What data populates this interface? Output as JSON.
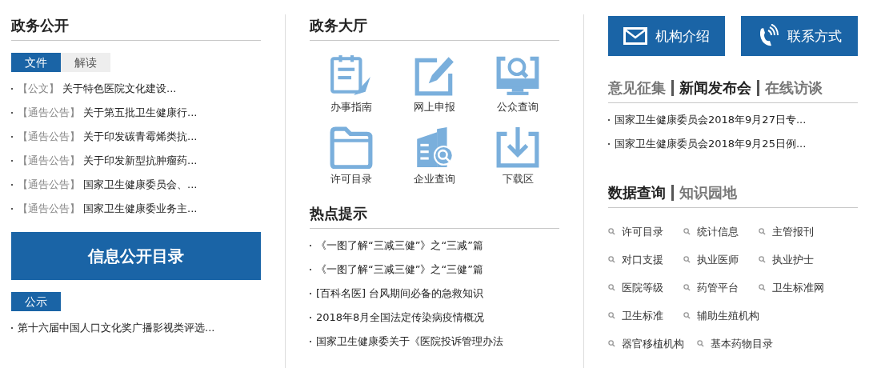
{
  "gov_open": {
    "title": "政务公开",
    "tabs": [
      {
        "label": "文件",
        "selected": true
      },
      {
        "label": "解读",
        "selected": false
      }
    ],
    "items": [
      {
        "tag": "【公文】",
        "text": "关于特色医院文化建设..."
      },
      {
        "tag": "【通告公告】",
        "text": "关于第五批卫生健康行..."
      },
      {
        "tag": "【通告公告】",
        "text": "关于印发碳青霉烯类抗..."
      },
      {
        "tag": "【通告公告】",
        "text": "关于印发新型抗肿瘤药..."
      },
      {
        "tag": "【通告公告】",
        "text": "国家卫生健康委员会、..."
      },
      {
        "tag": "【通告公告】",
        "text": "国家卫生健康委业务主..."
      }
    ],
    "catalog_button": "信息公开目录",
    "notice_tab": "公示",
    "notice_items": [
      "第十六届中国人口文化奖广播影视类评选..."
    ]
  },
  "hall": {
    "title": "政务大厅",
    "services": [
      {
        "kind": "guide",
        "label": "办事指南"
      },
      {
        "kind": "edit",
        "label": "网上申报"
      },
      {
        "kind": "monitor",
        "label": "公众查询"
      },
      {
        "kind": "folder",
        "label": "许可目录"
      },
      {
        "kind": "building",
        "label": "企业查询"
      },
      {
        "kind": "download",
        "label": "下载区"
      }
    ]
  },
  "hot": {
    "title": "热点提示",
    "items": [
      "《一图了解“三减三健”》之“三减”篇",
      "《一图了解“三减三健”》之“三健”篇",
      "[百科名医] 台风期间必备的急救知识",
      "2018年8月全国法定传染病疫情概况",
      "国家卫生健康委关于《医院投诉管理办法"
    ]
  },
  "quick_buttons": [
    {
      "kind": "mail",
      "label": "机构介绍"
    },
    {
      "kind": "phone",
      "label": "联系方式"
    }
  ],
  "news": {
    "tabs": [
      {
        "label": "意见征集",
        "selected": false
      },
      {
        "label": "新闻发布会",
        "selected": true
      },
      {
        "label": "在线访谈",
        "selected": false
      }
    ],
    "items": [
      "国家卫生健康委员会2018年9月27日专...",
      "国家卫生健康委员会2018年9月25日例..."
    ]
  },
  "data": {
    "tabs": [
      {
        "label": "数据查询",
        "selected": true
      },
      {
        "label": "知识园地",
        "selected": false
      }
    ],
    "links": [
      "许可目录",
      "统计信息",
      "主管报刊",
      "对口支援",
      "执业医师",
      "执业护士",
      "医院等级",
      "药管平台",
      "卫生标准网",
      "卫生标准",
      "辅助生殖机构",
      "器官移植机构",
      "基本药物目录"
    ]
  }
}
